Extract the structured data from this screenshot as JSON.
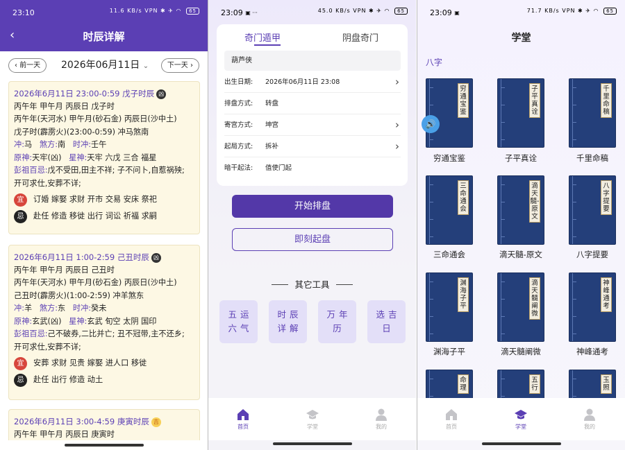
{
  "p1": {
    "status": {
      "time": "23:10",
      "net": "11.6 KB/s",
      "batt": "65"
    },
    "title": "时辰详解",
    "prev": "前一天",
    "next": "下一天",
    "date": "2026年06月11日",
    "cards": [
      {
        "title": "2026年6月11日 23:00-0:59 戊子时辰",
        "tag": "凶",
        "l1": "丙午年 甲午月 丙辰日 戊子时",
        "l2": "丙午年(天河水) 甲午月(砂石金) 丙辰日(沙中土)",
        "l3": "戊子时(霹雳火)(23:00-0:59) 冲马煞南",
        "chong_l": "冲:",
        "chong": "马",
        "sha_l": "煞方:",
        "sha": "南",
        "shi_l": "时冲:",
        "shi": "壬午",
        "yuan_l": "原神:",
        "yuan": "天牢(凶)",
        "xing_l": "星神:",
        "xing": "天牢 六戊 三合 福星",
        "peng_l": "彭祖百忌:",
        "peng": "戊不受田,田主不祥; 子不问卜,自惹祸殃; 开可求仕,安葬不详;",
        "yi_l": "宜",
        "yi": "订婚 嫁娶 求财 开市 交易 安床 祭祀",
        "ji_l": "忌",
        "ji": "赴任 修造 移徙 出行 词讼 祈福 求嗣"
      },
      {
        "title": "2026年6月11日 1:00-2:59 己丑时辰",
        "tag": "凶",
        "l1": "丙午年 甲午月 丙辰日 己丑时",
        "l2": "丙午年(天河水) 甲午月(砂石金) 丙辰日(沙中土)",
        "l3": "己丑时(霹雳火)(1:00-2:59) 冲羊煞东",
        "chong_l": "冲:",
        "chong": "羊",
        "sha_l": "煞方:",
        "sha": "东",
        "shi_l": "时冲:",
        "shi": "癸未",
        "yuan_l": "原神:",
        "yuan": "玄武(凶)",
        "xing_l": "星神:",
        "xing": "玄武 旬空 太阴 国印",
        "peng_l": "彭祖百忌:",
        "peng": "己不破券,二比并亡; 丑不冠带,主不还乡; 开可求仕,安葬不详;",
        "yi_l": "宜",
        "yi": "安葬 求财 见贵 嫁娶 进人口 移徙",
        "ji_l": "忌",
        "ji": "赴任 出行 修造 动土"
      },
      {
        "title": "2026年6月11日 3:00-4:59 庚寅时辰",
        "tag": "吉",
        "l1": "丙午年 甲午月 丙辰日 庚寅时"
      }
    ]
  },
  "p2": {
    "status": {
      "time": "23:09",
      "net": "45.0 KB/s",
      "batt": "65"
    },
    "tab_active": "奇门遁甲",
    "tab_other": "阴盘奇门",
    "name": "葫芦侠",
    "rows": [
      {
        "label": "出生日期:",
        "value": "2026年06月11日 23:08"
      },
      {
        "label": "排盘方式:",
        "value": "转盘"
      },
      {
        "label": "寄宫方式:",
        "value": "坤宫"
      },
      {
        "label": "起局方式:",
        "value": "拆补"
      },
      {
        "label": "暗干起法:",
        "value": "值使门起"
      }
    ],
    "btn_start": "开始排盘",
    "btn_now": "即刻起盘",
    "other_title": "其它工具",
    "tools": [
      "五运六气",
      "时辰详解",
      "万年历",
      "选吉日"
    ],
    "tabbar": [
      "首页",
      "学堂",
      "我的"
    ]
  },
  "p3": {
    "status": {
      "time": "23:09",
      "net": "71.7 KB/s",
      "batt": "65"
    },
    "title": "学堂",
    "section": "八字",
    "books": [
      {
        "label": "穷通宝鉴",
        "name": "穷通宝鉴"
      },
      {
        "label": "子平真诠",
        "name": "子平真诠"
      },
      {
        "label": "千里命稿",
        "name": "千里命稿"
      },
      {
        "label": "三命通会",
        "name": "三命通会"
      },
      {
        "label": "滴天髓-原文",
        "name": "滴天髓-原文"
      },
      {
        "label": "八字提要",
        "name": "八字提要"
      },
      {
        "label": "渊海子平",
        "name": "渊海子平"
      },
      {
        "label": "滴天髓阐微",
        "name": "滴天髓阐微"
      },
      {
        "label": "神峰通考",
        "name": "神峰通考"
      },
      {
        "label": "命理",
        "name": ""
      },
      {
        "label": "五行",
        "name": ""
      },
      {
        "label": "玉照",
        "name": ""
      }
    ],
    "tabbar": [
      "首页",
      "学堂",
      "我的"
    ]
  },
  "colors": {
    "accent": "#5b3fb4",
    "card_bg": "#fdf8e4",
    "yi": "#d7463c",
    "book": "#243f7a"
  }
}
